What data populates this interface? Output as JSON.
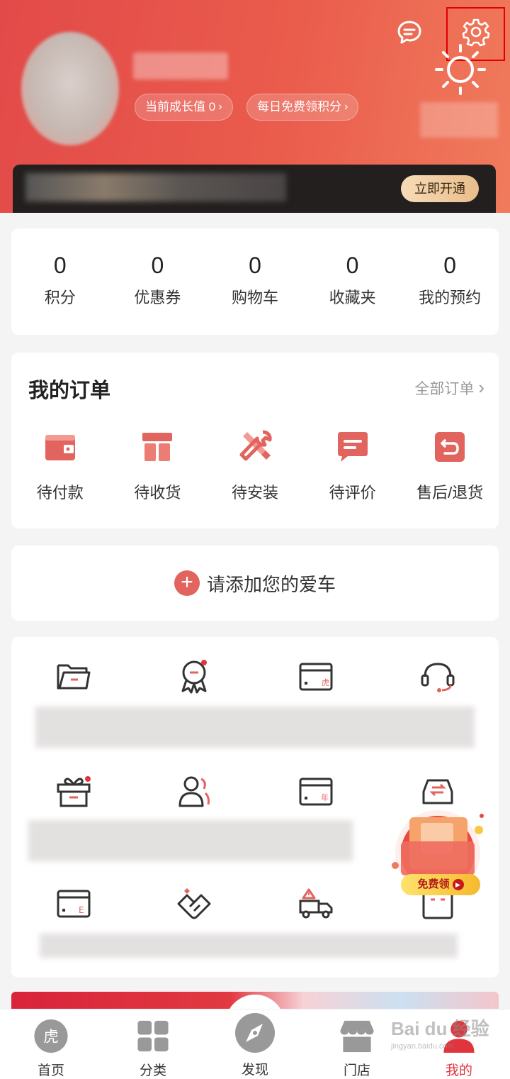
{
  "header": {
    "growth_pill": "当前成长值 0",
    "points_pill": "每日免费领积分",
    "chevron": "›",
    "vip_button": "立即开通",
    "icons": [
      "message-icon",
      "gear-icon",
      "sun-icon"
    ]
  },
  "stats": [
    {
      "value": "0",
      "label": "积分"
    },
    {
      "value": "0",
      "label": "优惠券"
    },
    {
      "value": "0",
      "label": "购物车"
    },
    {
      "value": "0",
      "label": "收藏夹"
    },
    {
      "value": "0",
      "label": "我的预约"
    }
  ],
  "orders": {
    "title": "我的订单",
    "all": "全部订单",
    "chevron": "›",
    "items": [
      {
        "label": "待付款",
        "icon": "wallet-icon"
      },
      {
        "label": "待收货",
        "icon": "package-icon"
      },
      {
        "label": "待安装",
        "icon": "tools-icon"
      },
      {
        "label": "待评价",
        "icon": "comment-icon"
      },
      {
        "label": "售后/退货",
        "icon": "return-icon"
      }
    ]
  },
  "add_car": {
    "plus": "+",
    "text": "请添加您的爱车"
  },
  "grid_icons": {
    "card_hu": "虎",
    "card_year": "年",
    "card_e": "E"
  },
  "floating_promo": {
    "label": "免费领",
    "play": "▶"
  },
  "tabbar": [
    {
      "label": "首页",
      "icon": "tiger-logo-icon",
      "glyph": "虎"
    },
    {
      "label": "分类",
      "icon": "grid-icon"
    },
    {
      "label": "发现",
      "icon": "compass-icon"
    },
    {
      "label": "门店",
      "icon": "store-icon"
    },
    {
      "label": "我的",
      "icon": "user-icon"
    }
  ],
  "watermark": {
    "brand": "Bai du 经验",
    "url": "jingyan.baidu.com"
  },
  "colors": {
    "header_start": "#e24a49",
    "header_end": "#f07b5c",
    "accent": "#e0353d",
    "icon_red": "#e2645e",
    "highlight_box": "#e00000",
    "vip_gold": "#e9bd8b"
  }
}
